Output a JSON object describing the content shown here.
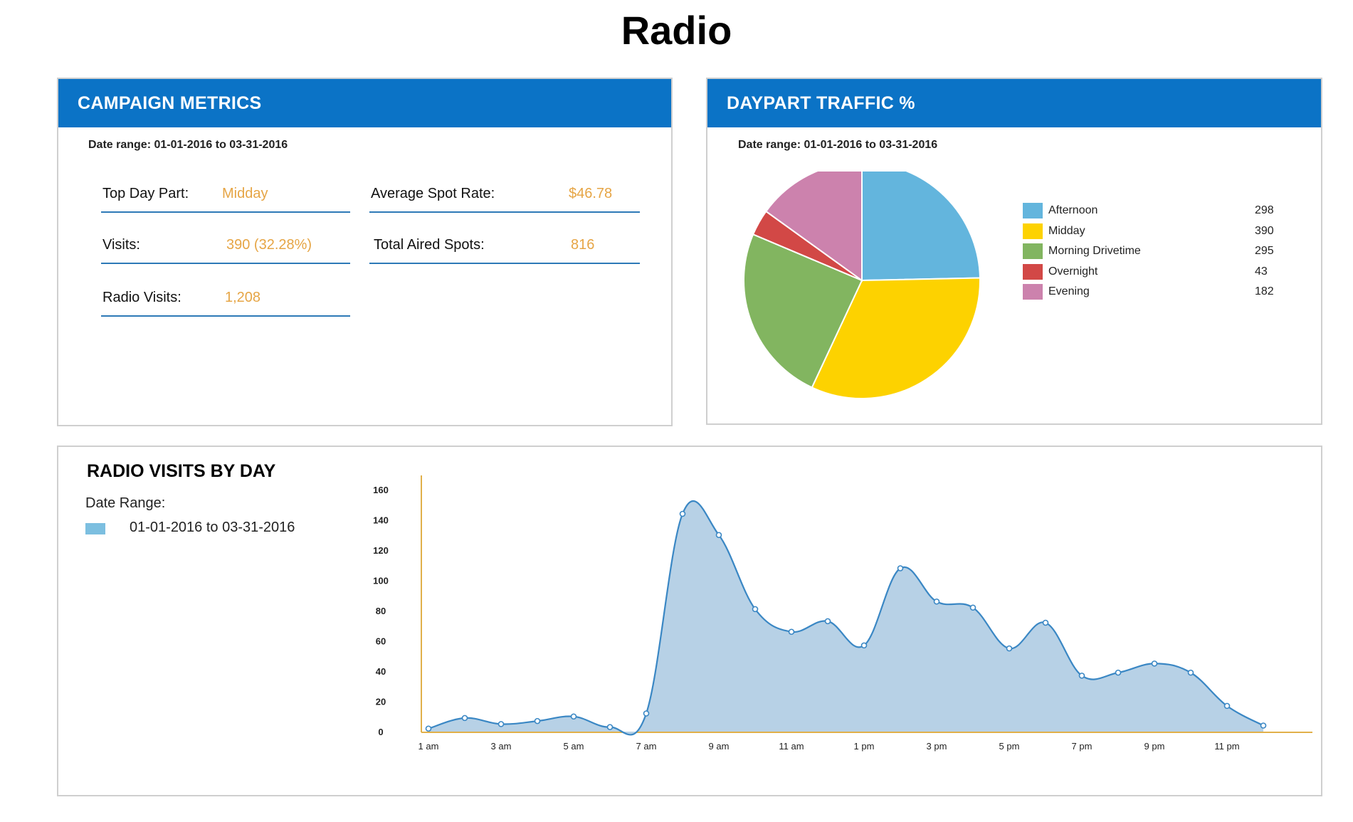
{
  "page": {
    "title": "Radio"
  },
  "campaign": {
    "header": "CAMPAIGN METRICS",
    "date_range": "Date range: 01-01-2016 to 03-31-2016",
    "metrics": {
      "top_day_part": {
        "label": "Top Day Part:",
        "value": "Midday"
      },
      "avg_spot_rate": {
        "label": "Average Spot Rate:",
        "value": "$46.78"
      },
      "visits": {
        "label": "Visits:",
        "value": "390 (32.28%)"
      },
      "total_aired_spots": {
        "label": "Total Aired Spots:",
        "value": "816"
      },
      "radio_visits": {
        "label": "Radio Visits:",
        "value": "1,208"
      }
    }
  },
  "daypart": {
    "header": "DAYPART TRAFFIC %",
    "date_range": "Date range: 01-01-2016 to 03-31-2016"
  },
  "visits_by_day": {
    "title": "RADIO VISITS BY DAY",
    "date_range_label": "Date Range:",
    "date_range_value": "01-01-2016 to 03-31-2016"
  },
  "colors": {
    "header_blue": "#0b73c6",
    "accent_value": "#e6a545",
    "metric_rule": "#2d79b7",
    "area_fill": "#b7d1e6",
    "area_line": "#3a87c4",
    "axis_gold": "#e1b04a",
    "legend_swatch": "#7cbfe0"
  },
  "chart_data": [
    {
      "type": "pie",
      "title": "",
      "slices": [
        {
          "label": "Afternoon",
          "value": 298,
          "color": "#63b5dd"
        },
        {
          "label": "Midday",
          "value": 390,
          "color": "#fdd200"
        },
        {
          "label": "Morning Drivetime",
          "value": 295,
          "color": "#82b560"
        },
        {
          "label": "Overnight",
          "value": 43,
          "color": "#d24846"
        },
        {
          "label": "Evening",
          "value": 182,
          "color": "#cc82ad"
        }
      ],
      "legend_position": "right"
    },
    {
      "type": "area",
      "title": "",
      "xlabel": "",
      "ylabel": "",
      "x": [
        "1 am",
        "2 am",
        "3 am",
        "4 am",
        "5 am",
        "6 am",
        "7 am",
        "8 am",
        "9 am",
        "10 am",
        "11 am",
        "12 pm",
        "1 pm",
        "2 pm",
        "3 pm",
        "4 pm",
        "5 pm",
        "6 pm",
        "7 pm",
        "8 pm",
        "9 pm",
        "10 pm",
        "11 pm",
        "12 am"
      ],
      "tick_labels": [
        "1 am",
        "3 am",
        "5 am",
        "7 am",
        "9 am",
        "11 am",
        "1 pm",
        "3 pm",
        "5 pm",
        "7 pm",
        "9 pm",
        "11 pm"
      ],
      "y_ticks": [
        0,
        20,
        40,
        60,
        80,
        100,
        120,
        140,
        160
      ],
      "ylim": [
        0,
        160
      ],
      "series": [
        {
          "values": [
            2,
            9,
            5,
            7,
            10,
            3,
            12,
            144,
            130,
            81,
            66,
            73,
            57,
            108,
            86,
            82,
            55,
            72,
            37,
            39,
            45,
            39,
            17,
            4
          ]
        }
      ],
      "grid": false
    }
  ]
}
